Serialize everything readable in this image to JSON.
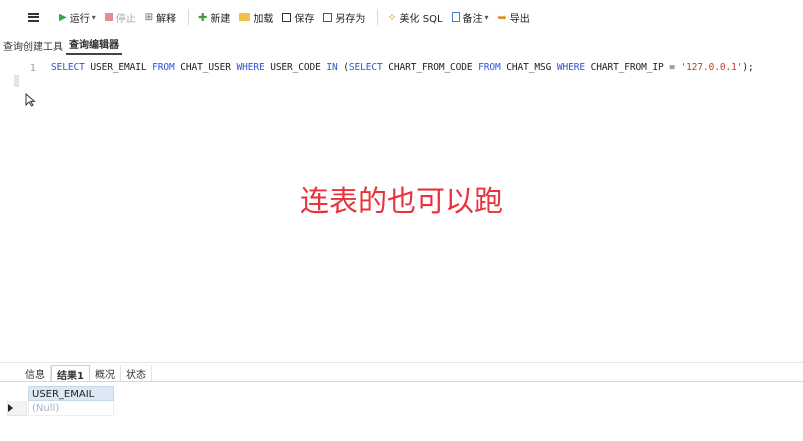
{
  "toolbar": {
    "run_label": "运行",
    "stop_label": "停止",
    "explain_label": "解释",
    "new_label": "新建",
    "load_label": "加载",
    "save_label": "保存",
    "saveas_label": "另存为",
    "beautify_label": "美化 SQL",
    "note_label": "备注",
    "export_label": "导出"
  },
  "subtabs": [
    "查询创建工具",
    "查询编辑器"
  ],
  "editor": {
    "line_number": "1",
    "tokens": [
      {
        "t": "SELECT",
        "k": "kw"
      },
      {
        "t": " USER_EMAIL ",
        "k": ""
      },
      {
        "t": "FROM",
        "k": "kw"
      },
      {
        "t": " CHAT_USER ",
        "k": ""
      },
      {
        "t": "WHERE",
        "k": "kw"
      },
      {
        "t": " USER_CODE ",
        "k": ""
      },
      {
        "t": "IN",
        "k": "kw"
      },
      {
        "t": " (",
        "k": ""
      },
      {
        "t": "SELECT",
        "k": "kw"
      },
      {
        "t": " CHART_FROM_CODE ",
        "k": ""
      },
      {
        "t": "FROM",
        "k": "kw"
      },
      {
        "t": " CHAT_MSG ",
        "k": ""
      },
      {
        "t": "WHERE",
        "k": "kw"
      },
      {
        "t": " CHART_FROM_IP = ",
        "k": ""
      },
      {
        "t": "'127.0.0.1'",
        "k": "str"
      },
      {
        "t": ");",
        "k": ""
      }
    ]
  },
  "annotation": "连表的也可以跑",
  "result_tabs": [
    "信息",
    "结果1",
    "概况",
    "状态"
  ],
  "result_grid": {
    "column": "USER_EMAIL",
    "value": "(Null)"
  },
  "colors": {
    "keyword": "#2f55d4",
    "string": "#c0392b",
    "annotation": "#e8323c",
    "run_icon": "#2eaa4a",
    "stop_icon": "#e05050"
  }
}
